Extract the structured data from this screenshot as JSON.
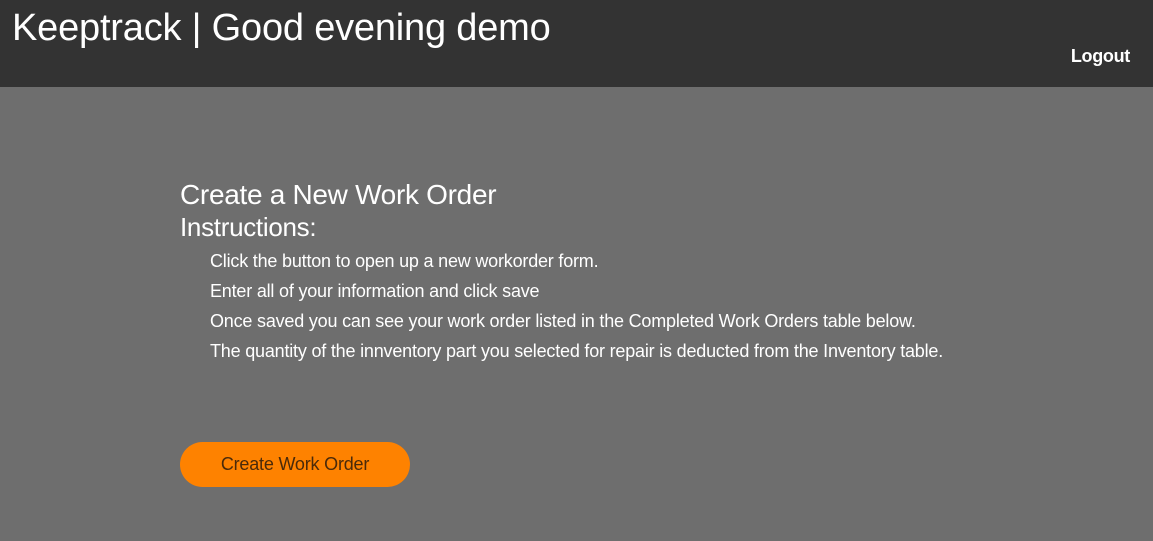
{
  "header": {
    "title": "Keeptrack | Good evening demo",
    "logout_label": "Logout"
  },
  "main": {
    "title": "Create a New Work Order",
    "instructions_heading": "Instructions:",
    "instructions": [
      "Click the button to open up a new workorder form.",
      "Enter all of your information and click save",
      "Once saved you can see your work order listed in the Completed Work Orders table below.",
      "The quantity of the innventory part you selected for repair is deducted from the Inventory table."
    ],
    "create_button_label": "Create Work Order"
  },
  "colors": {
    "header_bg": "#333333",
    "page_bg": "#6e6e6e",
    "accent": "#fe8200",
    "text": "#ffffff"
  }
}
